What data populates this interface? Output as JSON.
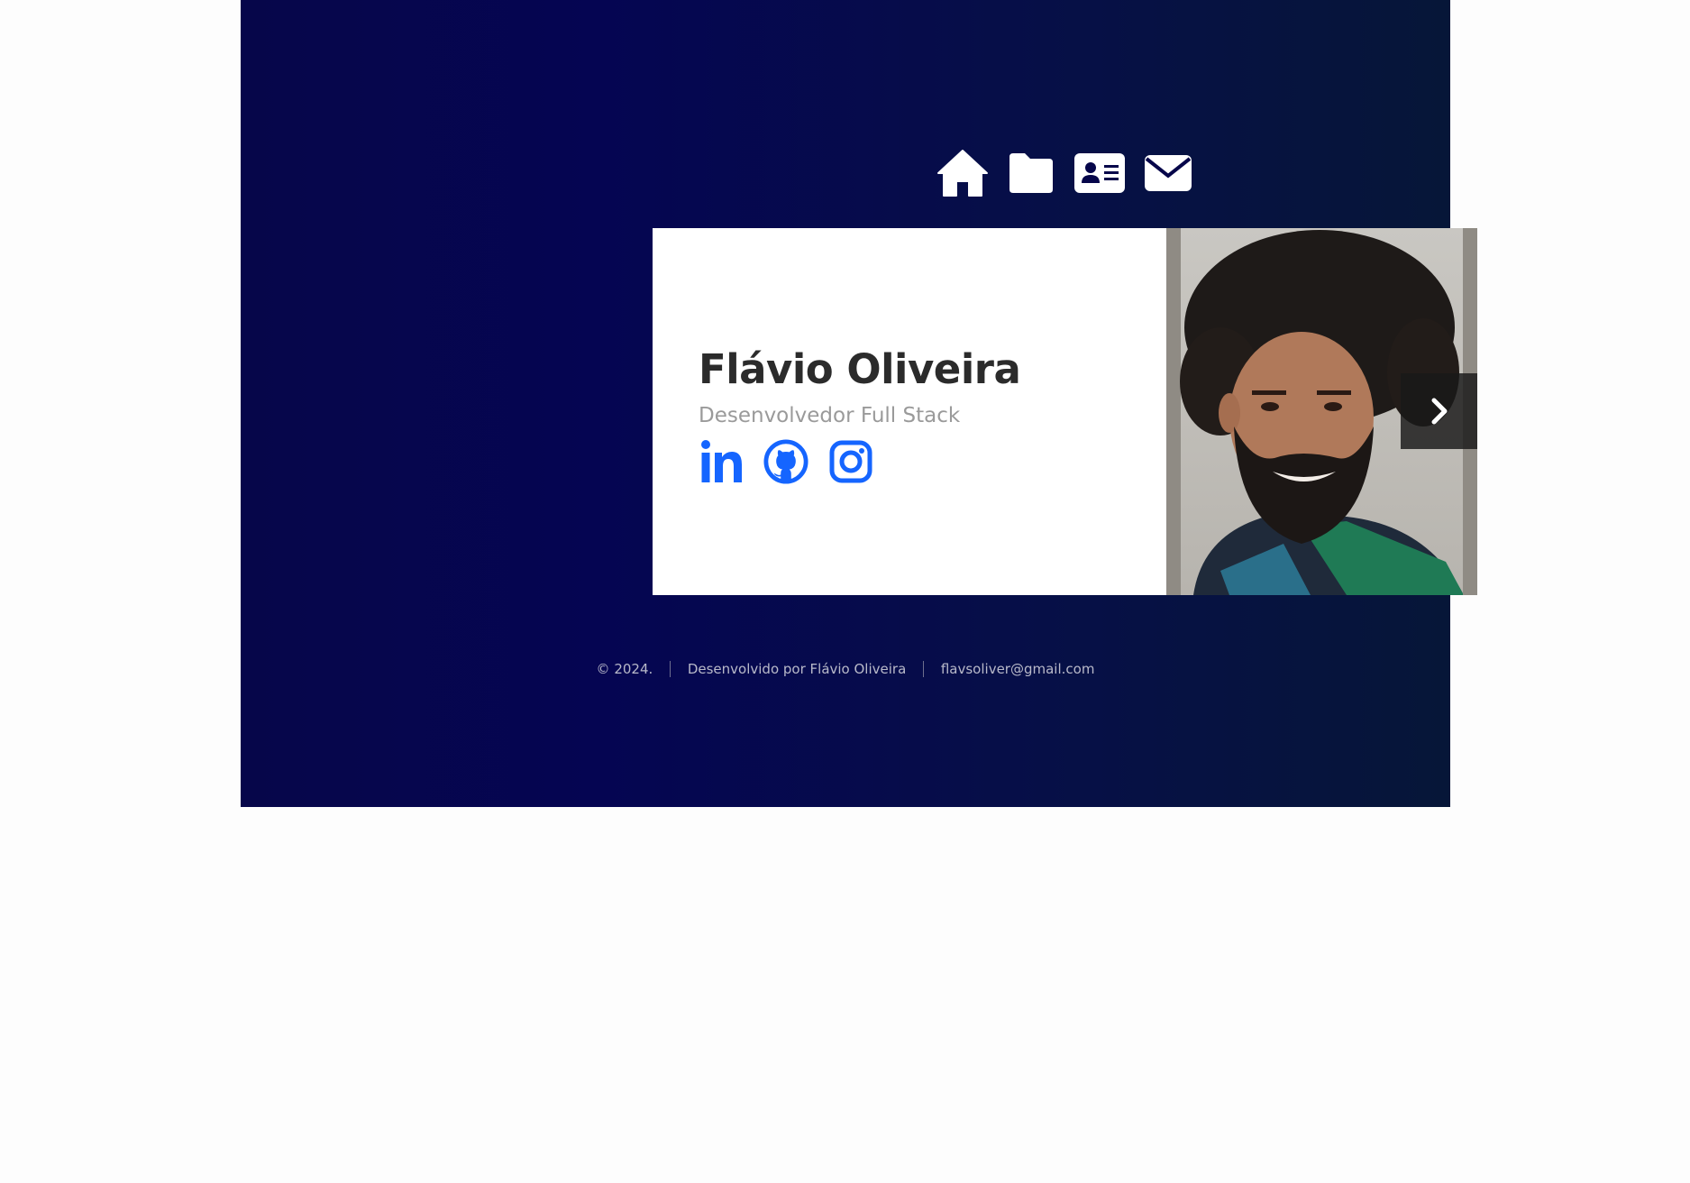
{
  "nav": {
    "items": [
      {
        "icon": "home-icon",
        "name": "nav-home"
      },
      {
        "icon": "folder-icon",
        "name": "nav-projects"
      },
      {
        "icon": "id-card-icon",
        "name": "nav-about"
      },
      {
        "icon": "envelope-icon",
        "name": "nav-contact"
      }
    ]
  },
  "card": {
    "name": "Flávio Oliveira",
    "role": "Desenvolvedor Full Stack",
    "social": [
      {
        "icon": "linkedin-icon"
      },
      {
        "icon": "github-icon"
      },
      {
        "icon": "instagram-icon"
      }
    ],
    "photo": {
      "icon": "profile-photo"
    },
    "next_icon": "chevron-right-icon"
  },
  "footer": {
    "copyright": "© 2024.",
    "credit": "Desenvolvido por Flávio Oliveira",
    "email": "flavsoliver@gmail.com"
  },
  "colors": {
    "hero_dark": "#050552",
    "accent": "#1565ff",
    "title": "#2b2b2b",
    "subtitle": "#9a9a9a"
  }
}
